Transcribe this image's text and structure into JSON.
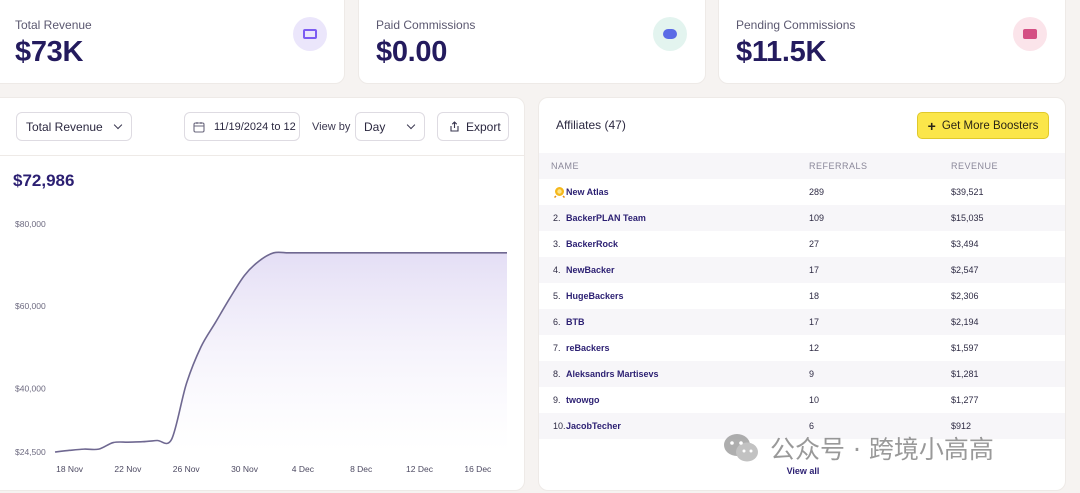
{
  "stats": [
    {
      "label": "Total Revenue",
      "value": "$73K",
      "icon": "cash-icon",
      "color": "#7c5cf2",
      "bg": "#ebe6fb"
    },
    {
      "label": "Paid Commissions",
      "value": "$0.00",
      "icon": "coins-icon",
      "color": "#5b6be6",
      "bg": "#e3f4ef"
    },
    {
      "label": "Pending Commissions",
      "value": "$11.5K",
      "icon": "ticket-icon",
      "color": "#d44f83",
      "bg": "#fbe4ea"
    }
  ],
  "chart_panel": {
    "metric_select": "Total Revenue",
    "date_range": "11/19/2024 to 12",
    "view_by_label": "View by",
    "view_by_value": "Day",
    "export_label": "Export",
    "total": "$72,986"
  },
  "chart_data": {
    "type": "area",
    "title": "",
    "xlabel": "",
    "ylabel": "",
    "y_ticks": [
      "$80,000",
      "$60,000",
      "$40,000",
      "$24,500"
    ],
    "y_tick_values": [
      80000,
      60000,
      40000,
      24500
    ],
    "ylim": [
      24500,
      80000
    ],
    "x_ticks": [
      "18 Nov",
      "22 Nov",
      "26 Nov",
      "30 Nov",
      "4 Dec",
      "8 Dec",
      "12 Dec",
      "16 Dec"
    ],
    "x": [
      "17 Nov",
      "18 Nov",
      "19 Nov",
      "20 Nov",
      "21 Nov",
      "22 Nov",
      "23 Nov",
      "24 Nov",
      "25 Nov",
      "26 Nov",
      "27 Nov",
      "28 Nov",
      "29 Nov",
      "30 Nov",
      "1 Dec",
      "2 Dec",
      "3 Dec",
      "4 Dec",
      "5 Dec",
      "6 Dec",
      "7 Dec",
      "8 Dec",
      "9 Dec",
      "10 Dec",
      "11 Dec",
      "12 Dec",
      "13 Dec",
      "14 Dec",
      "15 Dec",
      "16 Dec",
      "17 Dec",
      "18 Dec"
    ],
    "values": [
      24500,
      24900,
      25200,
      25200,
      26800,
      26900,
      27000,
      27300,
      27600,
      41000,
      50000,
      56000,
      62000,
      67500,
      71000,
      72986,
      72986,
      72986,
      72986,
      72986,
      72986,
      72986,
      72986,
      72986,
      72986,
      72986,
      72986,
      72986,
      72986,
      72986,
      72986,
      72986
    ],
    "line_color": "#6f6891",
    "fill_color": "#ede9f6",
    "grid": false
  },
  "affiliates": {
    "title": "Affiliates (47)",
    "boost_label": "Get More Boosters",
    "columns": [
      "NAME",
      "REFERRALS",
      "REVENUE"
    ],
    "rows": [
      {
        "rank": "",
        "name": "New Atlas",
        "referrals": "289",
        "revenue": "$39,521"
      },
      {
        "rank": "2.",
        "name": "BackerPLAN Team",
        "referrals": "109",
        "revenue": "$15,035"
      },
      {
        "rank": "3.",
        "name": "BackerRock",
        "referrals": "27",
        "revenue": "$3,494"
      },
      {
        "rank": "4.",
        "name": "NewBacker",
        "referrals": "17",
        "revenue": "$2,547"
      },
      {
        "rank": "5.",
        "name": "HugeBackers",
        "referrals": "18",
        "revenue": "$2,306"
      },
      {
        "rank": "6.",
        "name": "BTB",
        "referrals": "17",
        "revenue": "$2,194"
      },
      {
        "rank": "7.",
        "name": "reBackers",
        "referrals": "12",
        "revenue": "$1,597"
      },
      {
        "rank": "8.",
        "name": "Aleksandrs Martisevs",
        "referrals": "9",
        "revenue": "$1,281"
      },
      {
        "rank": "9.",
        "name": "twowgo",
        "referrals": "10",
        "revenue": "$1,277"
      },
      {
        "rank": "10.",
        "name": "JacobTecher",
        "referrals": "6",
        "revenue": "$912"
      }
    ],
    "view_all": "View all"
  },
  "watermark": "公众号 · 跨境小高高"
}
